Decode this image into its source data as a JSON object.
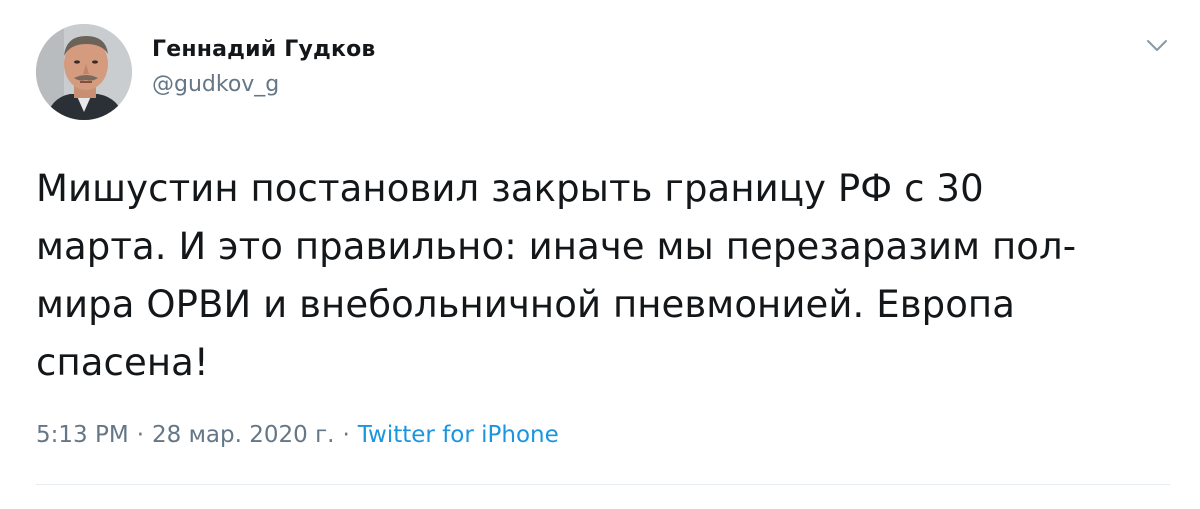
{
  "tweet": {
    "author": {
      "display_name": "Геннадий Гудков",
      "handle": "@gudkov_g",
      "avatar_icon": "avatar-photo"
    },
    "menu_icon": "chevron-down-icon",
    "text": "Мишустин постановил закрыть границу РФ с 30\nмарта. И это правильно: иначе мы перезаразим пол-\nмира ОРВИ и внебольничной пневмонией. Европа\nспасена!",
    "time": "5:13 PM",
    "separator": "·",
    "date": "28 мар. 2020 г.",
    "source": "Twitter for iPhone"
  },
  "colors": {
    "text": "#14171a",
    "secondary": "#657786",
    "link": "#1b95e0",
    "divider": "#e6ecf0"
  }
}
